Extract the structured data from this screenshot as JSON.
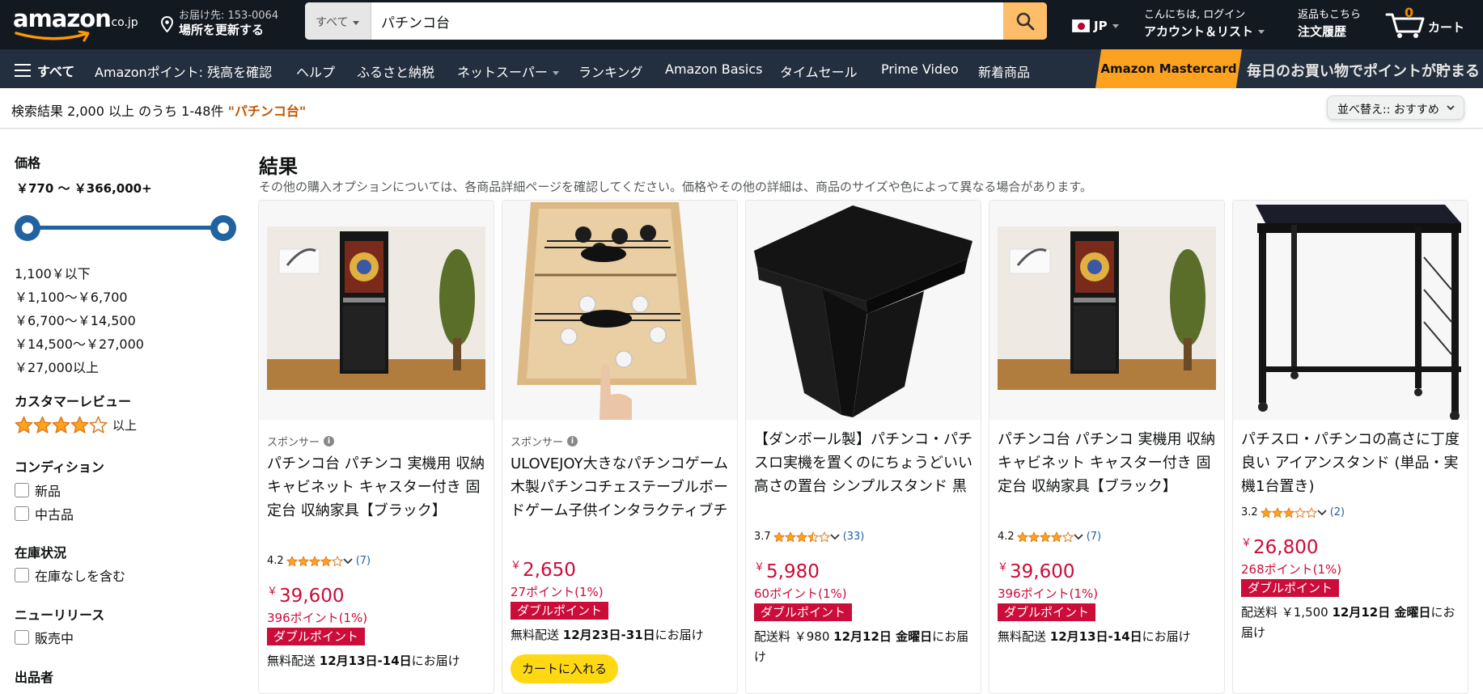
{
  "header": {
    "logo_text": "amazon",
    "logo_suffix": ".co.jp",
    "deliver_line1": "お届け先: 153-0064",
    "deliver_line2": "場所を更新する",
    "search_category": "すべて",
    "search_value": "パチンコ台",
    "lang_code": "JP",
    "account_line1": "こんにちは, ログイン",
    "account_line2": "アカウント＆リスト",
    "orders_line1": "返品もこちら",
    "orders_line2": "注文履歴",
    "cart_count": "0",
    "cart_label": "カート"
  },
  "subnav": {
    "all_label": "すべて",
    "items": [
      "Amazonポイント: 残高を確認",
      "ヘルプ",
      "ふるさと納税",
      "ネットスーパー",
      "ランキング",
      "Amazon Basics",
      "タイムセール",
      "Prime Video",
      "新着商品"
    ],
    "promo_label": "Amazon Mastercard",
    "promo_text": "毎日のお買い物でポイントが貯まる"
  },
  "result_bar": {
    "info": "検索結果 2,000 以上 のうち 1-48件 ",
    "query": "\"パチンコ台\"",
    "sort_label": "並べ替え:: おすすめ"
  },
  "sidebar": {
    "price_heading": "価格",
    "price_range": "￥770 〜 ￥366,000+",
    "price_options": [
      "1,100￥以下",
      "￥1,100〜￥6,700",
      "￥6,700〜￥14,500",
      "￥14,500〜￥27,000",
      "￥27,000以上"
    ],
    "review_heading": "カスタマーレビュー",
    "review_stars": 4,
    "review_suffix": "以上",
    "condition_heading": "コンディション",
    "condition_options": [
      "新品",
      "中古品"
    ],
    "stock_heading": "在庫状況",
    "stock_option": "在庫なしを含む",
    "new_heading": "ニューリリース",
    "new_option": "販売中",
    "seller_heading": "出品者"
  },
  "results": {
    "heading": "結果",
    "subtitle": "その他の購入オプションについては、各商品詳細ページを確認してください。価格やその他の詳細は、商品のサイズや色によって異なる場合があります。",
    "sponsored_label": "スポンサー",
    "double_points_label": "ダブルポイント",
    "products": [
      {
        "sponsored": true,
        "title": "パチンコ台 パチンコ 実機用 収納キャビネット キャスター付き 固定台 収納家具【ブラック】",
        "rating": "4.2",
        "stars": 4.0,
        "reviews": "(7)",
        "yen": "￥",
        "price": "39,600",
        "points": "396ポイント(1%)",
        "delivery_prefix": "無料配送 ",
        "delivery_bold": "12月13日-14日",
        "delivery_suffix": "にお届け"
      },
      {
        "sponsored": true,
        "title": "ULOVEJOY大きなパチンコゲーム木製パチンコチェステーブルボードゲーム子供インタラクティブチェスパチンコゲーム…",
        "yen": "￥",
        "price": "2,650",
        "points": "27ポイント(1%)",
        "delivery_prefix": "無料配送 ",
        "delivery_bold": "12月23日-31日",
        "delivery_suffix": "にお届け",
        "add_to_cart": "カートに入れる"
      },
      {
        "sponsored": false,
        "title": "【ダンボール製】パチンコ・パチスロ実機を置くのにちょうどいい高さの置台 シンプルスタンド 黒",
        "rating": "3.7",
        "stars": 3.5,
        "reviews": "(33)",
        "yen": "￥",
        "price": "5,980",
        "points": "60ポイント(1%)",
        "delivery_prefix": "配送料 ￥980 ",
        "delivery_bold": "12月12日 金曜日",
        "delivery_suffix": "にお届け"
      },
      {
        "sponsored": false,
        "title": "パチンコ台 パチンコ 実機用 収納キャビネット キャスター付き 固定台 収納家具【ブラック】",
        "rating": "4.2",
        "stars": 4.0,
        "reviews": "(7)",
        "yen": "￥",
        "price": "39,600",
        "points": "396ポイント(1%)",
        "delivery_prefix": "無料配送 ",
        "delivery_bold": "12月13日-14日",
        "delivery_suffix": "にお届け"
      },
      {
        "sponsored": false,
        "title": "パチスロ・パチンコの高さに丁度良い アイアンスタンド (単品・実機1台置き)",
        "rating": "3.2",
        "stars": 3.0,
        "reviews": "(2)",
        "yen": "￥",
        "price": "26,800",
        "points": "268ポイント(1%)",
        "delivery_prefix": "配送料 ￥1,500 ",
        "delivery_bold": "12月12日 金曜日",
        "delivery_suffix": "にお届け"
      }
    ]
  },
  "colors": {
    "nav_bg": "#131921",
    "subnav_bg": "#232f3e",
    "search_button": "#febd69",
    "price_red": "#cc0c39",
    "star_orange": "#ffa41c",
    "link_blue": "#2162a1",
    "add_cart_yellow": "#ffd814"
  }
}
